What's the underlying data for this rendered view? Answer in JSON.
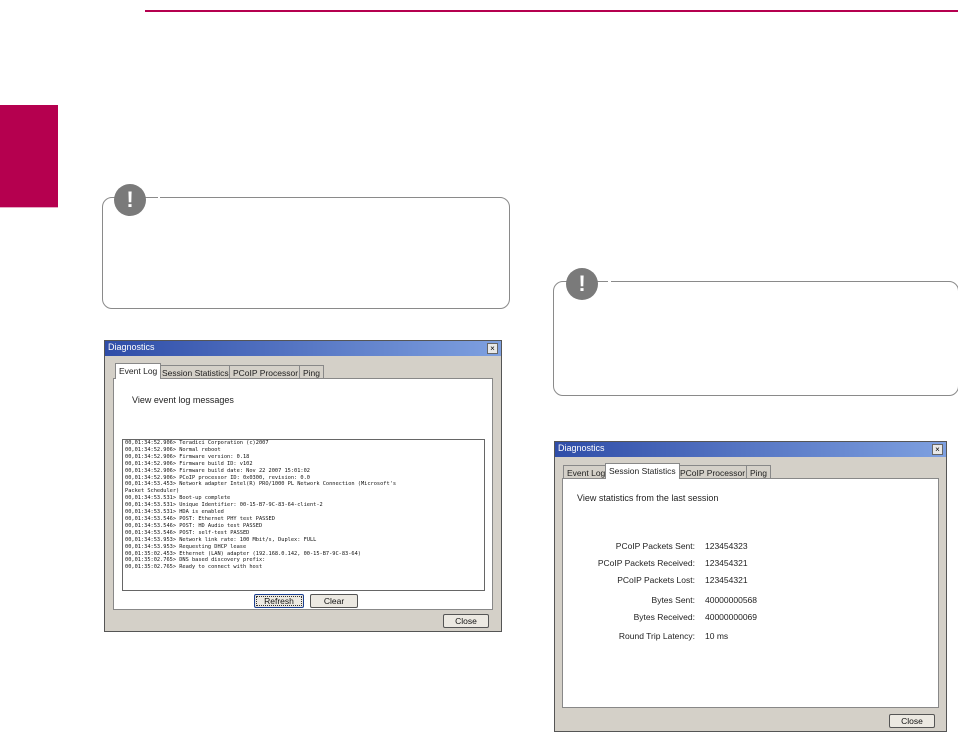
{
  "left_dialog": {
    "title": "Diagnostics",
    "tabs": [
      "Event Log",
      "Session Statistics",
      "PCoIP Processor",
      "Ping"
    ],
    "caption": "View event log messages",
    "log_lines": [
      "00,01:34:52.906> Teradici Corporation (c)2007",
      "00,01:34:52.906> Normal reboot",
      "00,01:34:52.906> Firmware version: 0.18",
      "00,01:34:52.906> Firmware build ID: v102",
      "00,01:34:52.906> Firmware build date: Nov 22 2007 15:01:02",
      "00,01:34:52.906> PCoIP processor ID: 0x0300, revision: 0.0",
      "00,01:34:53.453> Network adapter Intel(R) PRO/1000 PL Network Connection (Microsoft's",
      "Packet Scheduler)",
      "00,01:34:53.531> Boot-up complete",
      "00,01:34:53.531> Unique Identifier: 00-15-B7-9C-83-64-client-2",
      "00,01:34:53.531> HDA is enabled",
      "00,01:34:53.546> POST: Ethernet PHY test PASSED",
      "00,01:34:53.546> POST: HD Audio test PASSED",
      "00,01:34:53.546> POST: self-test PASSED",
      "00,01:34:53.953> Network link rate: 100 Mbit/s, Duplex: FULL",
      "00,01:34:53.953> Requesting DHCP lease",
      "00,01:35:02.453> Ethernet (LAN) adapter (192.168.0.142, 00-15-B7-9C-83-64)",
      "00,01:35:02.765> DNS based discovery prefix:",
      "00,01:35:02.765> Ready to connect with host"
    ],
    "refresh_label": "Refresh",
    "clear_label": "Clear",
    "close_label": "Close"
  },
  "right_dialog": {
    "title": "Diagnostics",
    "tabs": [
      "Event Log",
      "Session Statistics",
      "PCoIP Processor",
      "Ping"
    ],
    "caption": "View statistics from the last session",
    "stats": [
      {
        "label": "PCoIP Packets Sent:",
        "value": "123454323"
      },
      {
        "label": "PCoIP Packets Received:",
        "value": "123454321"
      },
      {
        "label": "PCoIP Packets Lost:",
        "value": "123454321"
      },
      {
        "label": "Bytes Sent:",
        "value": "40000000568"
      },
      {
        "label": "Bytes Received:",
        "value": "40000000069"
      },
      {
        "label": "Round Trip Latency:",
        "value": "10 ms"
      }
    ],
    "close_label": "Close"
  },
  "note_symbol": "!",
  "colors": {
    "accent": "#b5004f"
  }
}
